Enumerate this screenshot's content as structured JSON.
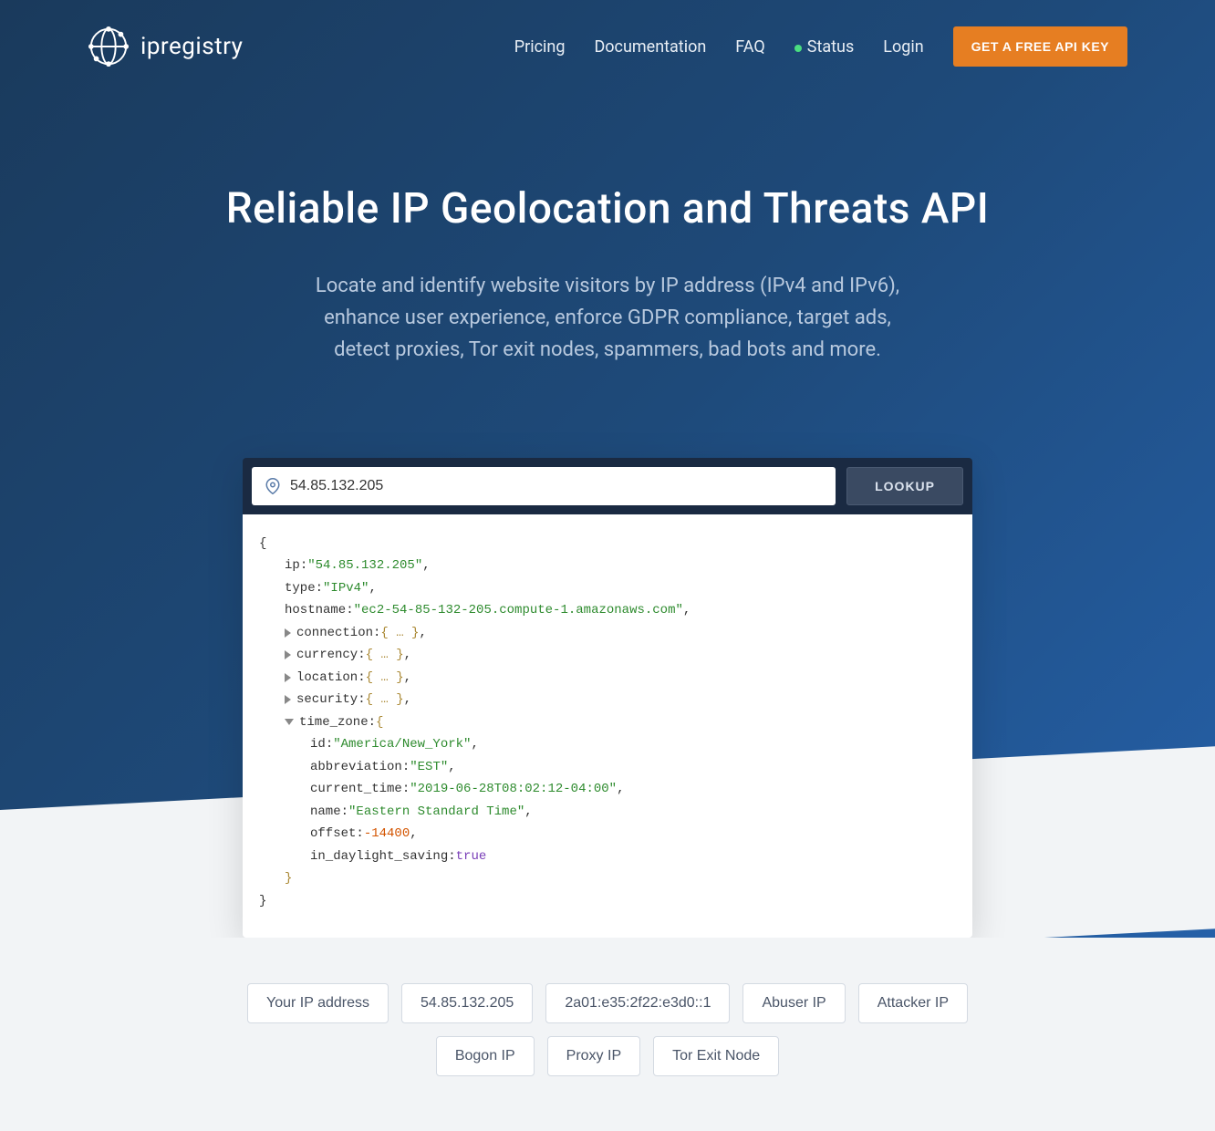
{
  "brand": "ipregistry",
  "nav": {
    "pricing": "Pricing",
    "docs": "Documentation",
    "faq": "FAQ",
    "status": "Status",
    "login": "Login",
    "cta": "GET A FREE API KEY"
  },
  "hero": {
    "title": "Reliable IP Geolocation and Threats API",
    "sub1": "Locate and identify website visitors by IP address (IPv4 and IPv6),",
    "sub2": "enhance user experience, enforce GDPR compliance, target ads,",
    "sub3": "detect proxies, Tor exit nodes, spammers, bad bots and more."
  },
  "lookup": {
    "value": "54.85.132.205",
    "button": "LOOKUP"
  },
  "json": {
    "ip_key": "ip",
    "ip_val": "\"54.85.132.205\"",
    "type_key": "type",
    "type_val": "\"IPv4\"",
    "hostname_key": "hostname",
    "hostname_val": "\"ec2-54-85-132-205.compute-1.amazonaws.com\"",
    "connection_key": "connection",
    "currency_key": "currency",
    "location_key": "location",
    "security_key": "security",
    "timezone_key": "time_zone",
    "tz_id_key": "id",
    "tz_id_val": "\"America/New_York\"",
    "tz_abbr_key": "abbreviation",
    "tz_abbr_val": "\"EST\"",
    "tz_ct_key": "current_time",
    "tz_ct_val": "\"2019-06-28T08:02:12-04:00\"",
    "tz_name_key": "name",
    "tz_name_val": "\"Eastern Standard Time\"",
    "tz_offset_key": "offset",
    "tz_offset_val": "-14400",
    "tz_dst_key": "in_daylight_saving",
    "tz_dst_val": "true",
    "collapsed": "{ … }"
  },
  "chips": {
    "your_ip": "Your IP address",
    "v4": "54.85.132.205",
    "v6": "2a01:e35:2f22:e3d0::1",
    "abuser": "Abuser IP",
    "attacker": "Attacker IP",
    "bogon": "Bogon IP",
    "proxy": "Proxy IP",
    "tor": "Tor Exit Node"
  }
}
